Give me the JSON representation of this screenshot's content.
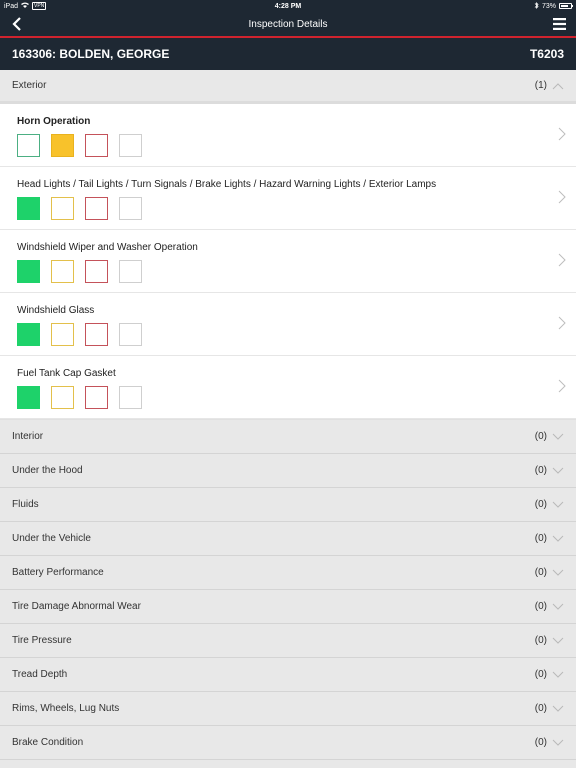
{
  "status": {
    "device": "iPad",
    "carrier": "VPN",
    "time": "4:28 PM",
    "battery": "73%"
  },
  "nav": {
    "title": "Inspection Details"
  },
  "header": {
    "name": "163306: BOLDEN, GEORGE",
    "unit": "T6203"
  },
  "exterior": {
    "label": "Exterior",
    "count": "(1)",
    "items": [
      {
        "title": "Horn Operation",
        "selected": "yellow"
      },
      {
        "title": "Head Lights / Tail Lights / Turn Signals / Brake Lights / Hazard Warning Lights / Exterior Lamps",
        "selected": "green"
      },
      {
        "title": "Windshield Wiper and Washer Operation",
        "selected": "green"
      },
      {
        "title": "Windshield Glass",
        "selected": "green"
      },
      {
        "title": "Fuel Tank Cap Gasket",
        "selected": "green"
      }
    ]
  },
  "sections": [
    {
      "label": "Interior",
      "count": "(0)"
    },
    {
      "label": "Under the Hood",
      "count": "(0)"
    },
    {
      "label": "Fluids",
      "count": "(0)"
    },
    {
      "label": "Under the Vehicle",
      "count": "(0)"
    },
    {
      "label": "Battery Performance",
      "count": "(0)"
    },
    {
      "label": "Tire Damage Abnormal Wear",
      "count": "(0)"
    },
    {
      "label": "Tire Pressure",
      "count": "(0)"
    },
    {
      "label": "Tread Depth",
      "count": "(0)"
    },
    {
      "label": "Rims, Wheels, Lug Nuts",
      "count": "(0)"
    },
    {
      "label": "Brake Condition",
      "count": "(0)"
    }
  ],
  "colors": {
    "nav_bg": "#1e2833",
    "accent_red": "#d0232e",
    "status_green": "#1ed26a",
    "status_yellow": "#f8c22b",
    "status_red": "#c4525a"
  }
}
